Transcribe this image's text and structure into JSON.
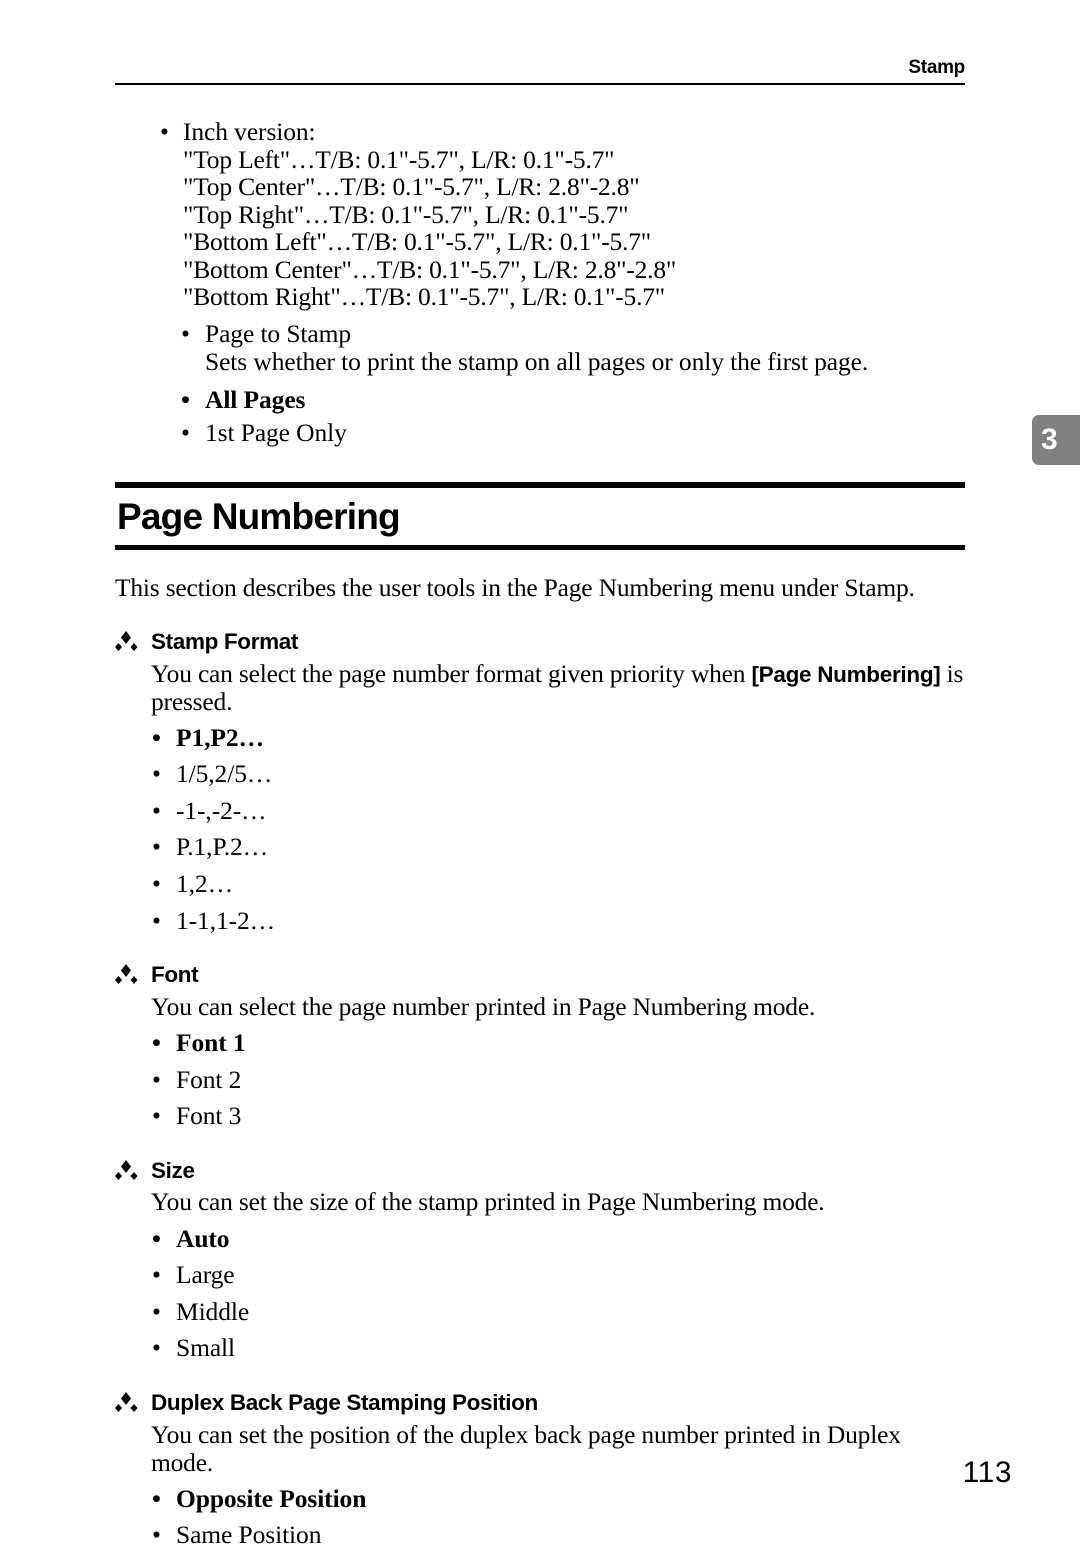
{
  "header": {
    "running_title": "Stamp"
  },
  "chapter_tab": {
    "number": "3",
    "color": "#808080",
    "text_color": "#ffffff"
  },
  "top_list": {
    "bullet_glyph": "•",
    "items": [
      {
        "label": "Inch version:",
        "lines": [
          "\"Top Left\"…T/B: 0.1\"-5.7\", L/R: 0.1\"-5.7\"",
          "\"Top Center\"…T/B: 0.1\"-5.7\", L/R: 2.8\"-2.8\"",
          "\"Top Right\"…T/B: 0.1\"-5.7\", L/R: 0.1\"-5.7\"",
          "\"Bottom Left\"…T/B: 0.1\"-5.7\", L/R: 0.1\"-5.7\"",
          "\"Bottom Center\"…T/B: 0.1\"-5.7\", L/R: 2.8\"-2.8\"",
          "\"Bottom Right\"…T/B: 0.1\"-5.7\", L/R: 0.1\"-5.7\""
        ]
      },
      {
        "label": "Page to Stamp",
        "lines": [
          "Sets whether to print the stamp on all pages or only the first page."
        ]
      }
    ],
    "options": [
      {
        "label": "All Pages",
        "default": true
      },
      {
        "label": "1st Page Only",
        "default": false
      }
    ]
  },
  "section": {
    "title": "Page Numbering",
    "intro": "This section describes the user tools in the Page Numbering menu under Stamp."
  },
  "subsections": [
    {
      "title": "Stamp Format",
      "desc_before": "You can select the page number format given priority when ",
      "desc_key": "[Page Numbering]",
      "desc_after": " is pressed.",
      "options": [
        {
          "label": "P1,P2…",
          "default": true
        },
        {
          "label": "1/5,2/5…",
          "default": false
        },
        {
          "label": "-1-,-2-…",
          "default": false
        },
        {
          "label": "P.1,P.2…",
          "default": false
        },
        {
          "label": "1,2…",
          "default": false
        },
        {
          "label": "1-1,1-2…",
          "default": false
        }
      ]
    },
    {
      "title": "Font",
      "desc_before": "You can select the page number printed in Page Numbering mode.",
      "desc_key": "",
      "desc_after": "",
      "options": [
        {
          "label": "Font 1",
          "default": true
        },
        {
          "label": "Font 2",
          "default": false
        },
        {
          "label": "Font 3",
          "default": false
        }
      ]
    },
    {
      "title": "Size",
      "desc_before": "You can set the size of the stamp printed in Page Numbering mode.",
      "desc_key": "",
      "desc_after": "",
      "options": [
        {
          "label": "Auto",
          "default": true
        },
        {
          "label": "Large",
          "default": false
        },
        {
          "label": "Middle",
          "default": false
        },
        {
          "label": "Small",
          "default": false
        }
      ]
    },
    {
      "title": "Duplex Back Page Stamping Position",
      "desc_before": "You can set the position of the duplex back page number printed in Duplex mode.",
      "desc_key": "",
      "desc_after": "",
      "options": [
        {
          "label": "Opposite Position",
          "default": true
        },
        {
          "label": "Same Position",
          "default": false
        }
      ]
    }
  ],
  "footer": {
    "page_number": "113"
  },
  "icons": {
    "diamond_bullet": "diamond-cluster-icon",
    "round_bullet": "•"
  }
}
